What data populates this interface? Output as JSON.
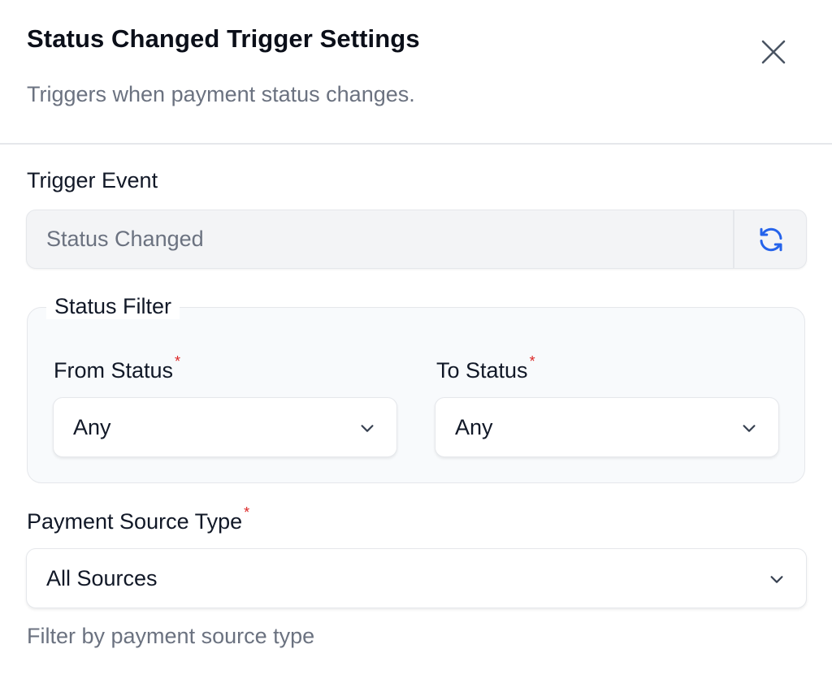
{
  "dialog": {
    "title": "Status Changed Trigger Settings",
    "subtitle": "Triggers when payment status changes.",
    "close_icon": "close-icon"
  },
  "trigger_event": {
    "label": "Trigger Event",
    "value": "Status Changed",
    "refresh_icon": "refresh-icon",
    "icon_color": "#2563eb"
  },
  "status_filter": {
    "legend": "Status Filter",
    "from": {
      "label": "From Status",
      "required_mark": "*",
      "value": "Any"
    },
    "to": {
      "label": "To Status",
      "required_mark": "*",
      "value": "Any"
    }
  },
  "payment_source": {
    "label": "Payment Source Type",
    "required_mark": "*",
    "value": "All Sources",
    "helper": "Filter by payment source type"
  },
  "colors": {
    "required": "#dc2626",
    "accent": "#2563eb",
    "muted_text": "#6b7280"
  }
}
